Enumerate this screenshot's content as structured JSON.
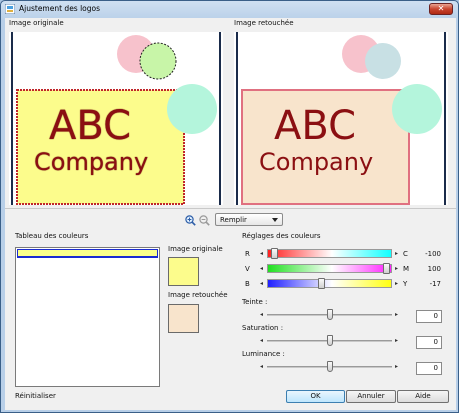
{
  "window": {
    "title": "Ajustement des logos",
    "close_glyph": "✕"
  },
  "preview": {
    "original_label": "Image originale",
    "adjusted_label": "Image retouchée",
    "logo_text_line1": "ABC",
    "logo_text_line2": "Company"
  },
  "toolbar": {
    "zoom_in_icon": "zoom-in-icon",
    "zoom_out_icon": "zoom-out-icon",
    "mode_selected": "Remplir"
  },
  "color_table": {
    "label": "Tableau des couleurs"
  },
  "swatches": {
    "original_label": "Image originale",
    "original_color": "#fcfc8c",
    "adjusted_label": "Image retouchée",
    "adjusted_color": "#f8e4cc"
  },
  "color_adjust": {
    "label": "Réglages des couleurs",
    "rows": [
      {
        "left": "R",
        "right": "C",
        "value": "-100"
      },
      {
        "left": "V",
        "right": "M",
        "value": "100"
      },
      {
        "left": "B",
        "right": "Y",
        "value": "-17"
      }
    ]
  },
  "sliders": [
    {
      "label": "Teinte :",
      "value": "0"
    },
    {
      "label": "Saturation :",
      "value": "0"
    },
    {
      "label": "Luminance :",
      "value": "0"
    }
  ],
  "footer": {
    "reset_label": "Réinitialiser",
    "ok_label": "OK",
    "cancel_label": "Annuler",
    "help_label": "Aide"
  },
  "colors": {
    "logo_text": "#8b0f12",
    "original_logo_bg": "#fcfc8c",
    "adjusted_logo_bg": "#f8e4cc"
  }
}
